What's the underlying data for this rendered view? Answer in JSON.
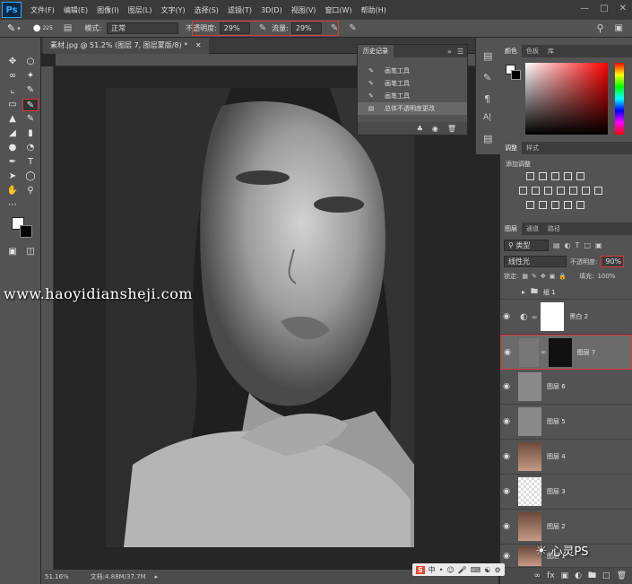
{
  "menu": {
    "logo": "Ps",
    "items": [
      "文件(F)",
      "编辑(E)",
      "图像(I)",
      "图层(L)",
      "文字(Y)",
      "选择(S)",
      "滤镜(T)",
      "3D(D)",
      "视图(V)",
      "窗口(W)",
      "帮助(H)"
    ]
  },
  "options": {
    "brush_size": "225",
    "mode_label": "模式:",
    "mode_value": "正常",
    "opacity_label": "不透明度:",
    "opacity_value": "29%",
    "flow_label": "流量:",
    "flow_value": "29%"
  },
  "document": {
    "tab_title": "素材.jpg @ 51.2% (图层 7, 图层蒙版/8) *",
    "zoom": "51.16%",
    "doc_info": "文档:4.88M/37.7M"
  },
  "watermark": "www.haoyidiansheji.com",
  "history": {
    "tab": "历史记录",
    "items": [
      {
        "label": "画笔工具",
        "selected": false
      },
      {
        "label": "画笔工具",
        "selected": false
      },
      {
        "label": "画笔工具",
        "selected": false
      },
      {
        "label": "总体不透明度更改",
        "selected": true
      }
    ]
  },
  "color_panel": {
    "tabs": [
      "颜色",
      "色板",
      "库"
    ]
  },
  "adjustments_panel": {
    "tabs": [
      "调整",
      "样式"
    ],
    "title": "添加调整"
  },
  "layers_panel": {
    "tabs": [
      "图层",
      "通道",
      "路径"
    ],
    "kind_filter": "类型",
    "blend_mode": "线性光",
    "opacity_label": "不透明度:",
    "opacity_value": "90%",
    "lock_label": "锁定:",
    "fill_label": "填充:",
    "fill_value": "100%",
    "layers": [
      {
        "name": "组 1",
        "type": "group"
      },
      {
        "name": "黑白 2",
        "type": "adjustment"
      },
      {
        "name": "图层 7",
        "type": "masked",
        "selected": true
      },
      {
        "name": "图层 6",
        "type": "gray"
      },
      {
        "name": "图层 5",
        "type": "gray"
      },
      {
        "name": "图层 4",
        "type": "photo"
      },
      {
        "name": "图层 3",
        "type": "transparent"
      },
      {
        "name": "图层 2",
        "type": "photo"
      },
      {
        "name": "图层 1",
        "type": "photo"
      }
    ]
  },
  "social_watermark": "心灵PS",
  "ime_label": "中"
}
